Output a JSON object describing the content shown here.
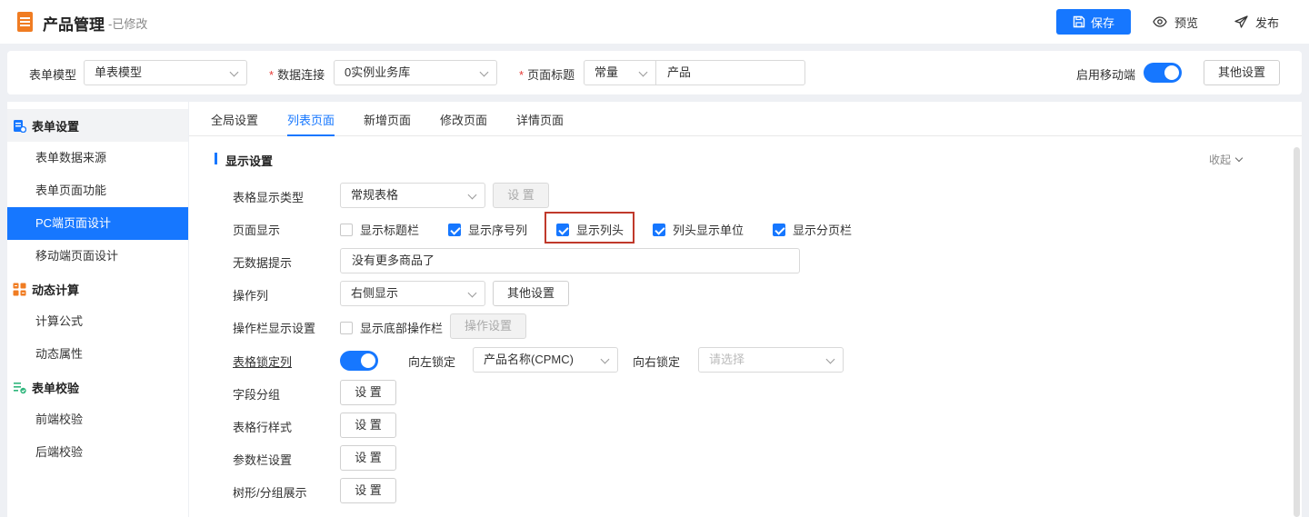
{
  "header": {
    "title": "产品管理",
    "status": "-已修改",
    "save_label": "保存",
    "preview_label": "预览",
    "publish_label": "发布"
  },
  "config": {
    "form_model_label": "表单模型",
    "form_model_value": "单表模型",
    "data_conn_label": "数据连接",
    "data_conn_value": "0实例业务库",
    "page_title_label": "页面标题",
    "page_title_type": "常量",
    "page_title_value": "产品",
    "mobile_label": "启用移动端",
    "mobile_enabled": true,
    "other_settings_label": "其他设置"
  },
  "sidebar": {
    "groups": [
      {
        "label": "表单设置",
        "icon": "form-settings-icon",
        "items": [
          "表单数据来源",
          "表单页面功能",
          "PC端页面设计",
          "移动端页面设计"
        ]
      },
      {
        "label": "动态计算",
        "icon": "calc-icon",
        "items": [
          "计算公式",
          "动态属性"
        ]
      },
      {
        "label": "表单校验",
        "icon": "validate-icon",
        "items": [
          "前端校验",
          "后端校验"
        ]
      }
    ],
    "active_item": "PC端页面设计"
  },
  "tabs": [
    "全局设置",
    "列表页面",
    "新增页面",
    "修改页面",
    "详情页面"
  ],
  "active_tab": "列表页面",
  "section": {
    "title": "显示设置",
    "collapse_label": "收起"
  },
  "rows": {
    "table_type_label": "表格显示类型",
    "table_type_value": "常规表格",
    "table_type_btn": "设 置",
    "page_display_label": "页面显示",
    "checkboxes": [
      {
        "label": "显示标题栏",
        "checked": false
      },
      {
        "label": "显示序号列",
        "checked": true
      },
      {
        "label": "显示列头",
        "checked": true
      },
      {
        "label": "列头显示单位",
        "checked": true
      },
      {
        "label": "显示分页栏",
        "checked": true
      }
    ],
    "no_data_label": "无数据提示",
    "no_data_value": "没有更多商品了",
    "op_col_label": "操作列",
    "op_col_value": "右侧显示",
    "op_col_btn": "其他设置",
    "op_bar_label": "操作栏显示设置",
    "op_bar_cb_label": "显示底部操作栏",
    "op_bar_cb_checked": false,
    "op_bar_btn": "操作设置",
    "lock_label": "表格锁定列",
    "lock_enabled": true,
    "lock_left_label": "向左锁定",
    "lock_left_value": "产品名称(CPMC)",
    "lock_right_label": "向右锁定",
    "lock_right_placeholder": "请选择",
    "field_group_label": "字段分组",
    "row_style_label": "表格行样式",
    "param_bar_label": "参数栏设置",
    "tree_label": "树形/分组展示",
    "set_btn": "设 置"
  }
}
